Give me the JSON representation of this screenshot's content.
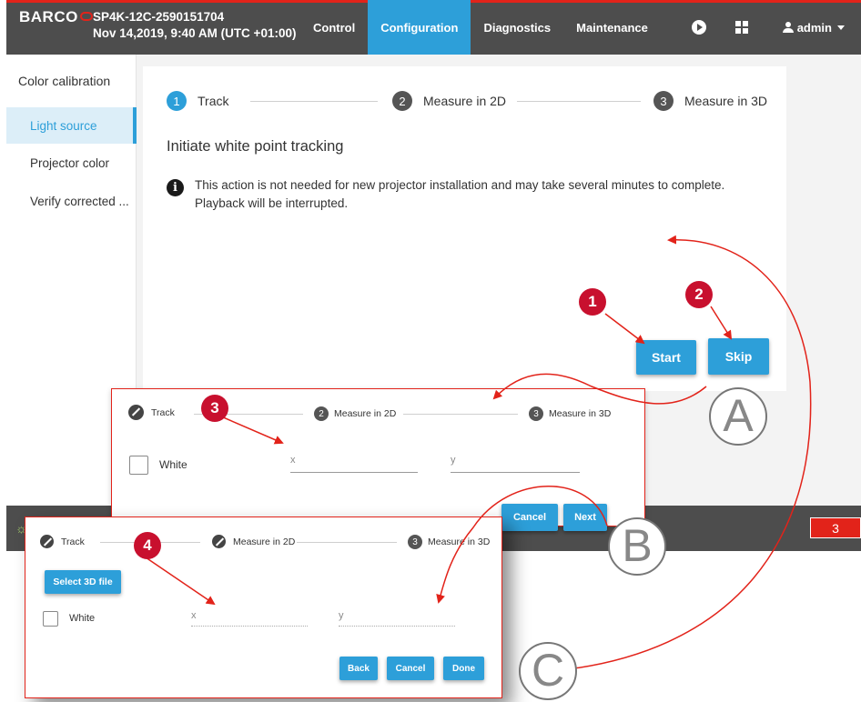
{
  "topbar": {
    "logo": "BARCO",
    "device_name": "SP4K-12C-2590151704",
    "device_datetime": "Nov 14,2019, 9:40 AM (UTC +01:00)",
    "tabs": [
      "Control",
      "Configuration",
      "Diagnostics",
      "Maintenance"
    ],
    "active_tab": "Configuration",
    "user": "admin"
  },
  "sidebar": {
    "title": "Color calibration",
    "items": [
      "Light source",
      "Projector color",
      "Verify corrected ..."
    ],
    "active_item": "Light source"
  },
  "main": {
    "steps": [
      {
        "num": "1",
        "label": "Track"
      },
      {
        "num": "2",
        "label": "Measure in 2D"
      },
      {
        "num": "3",
        "label": "Measure in 3D"
      }
    ],
    "heading": "Initiate white point tracking",
    "info": "This action is not needed for new projector installation and may take several minutes to complete. Playback will be interrupted.",
    "start_label": "Start",
    "skip_label": "Skip"
  },
  "footer": {
    "error_count": "3"
  },
  "panel_b": {
    "steps": [
      {
        "num": "",
        "label": "Track"
      },
      {
        "num": "2",
        "label": "Measure in 2D"
      },
      {
        "num": "3",
        "label": "Measure in 3D"
      }
    ],
    "row_label": "White",
    "x_placeholder": "x",
    "y_placeholder": "y",
    "cancel_label": "Cancel",
    "next_label": "Next"
  },
  "panel_c": {
    "steps": [
      {
        "num": "",
        "label": "Track"
      },
      {
        "num": "",
        "label": "Measure in 2D"
      },
      {
        "num": "3",
        "label": "Measure in 3D"
      }
    ],
    "select_file_label": "Select 3D file",
    "row_label": "White",
    "x_placeholder": "x",
    "y_placeholder": "y",
    "back_label": "Back",
    "cancel_label": "Cancel",
    "done_label": "Done"
  },
  "callouts": {
    "numbers": [
      "1",
      "2",
      "3",
      "4"
    ],
    "letters": [
      "A",
      "B",
      "C"
    ]
  },
  "colors": {
    "accent_blue": "#2d9fd9",
    "barco_red": "#e2231a",
    "callout_red": "#c8102e",
    "bar_gray": "#4d4d4d"
  }
}
